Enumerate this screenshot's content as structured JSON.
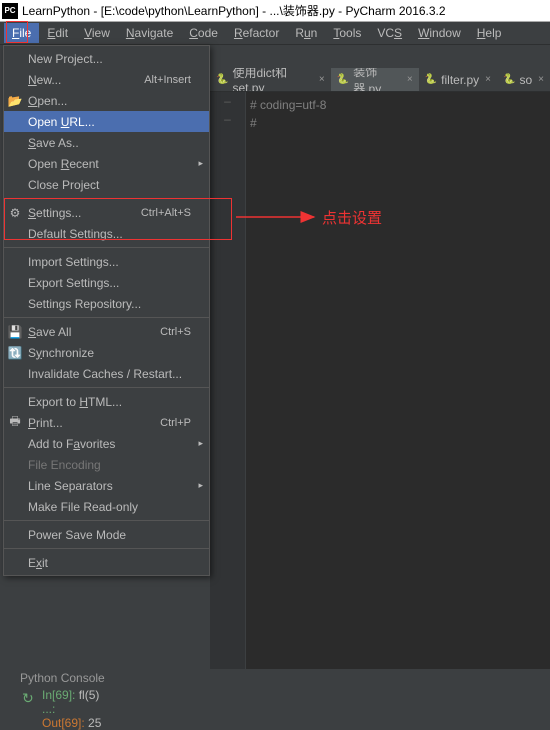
{
  "titlebar": {
    "icon_text": "PC",
    "title": "LearnPython - [E:\\code\\python\\LearnPython] - ...\\装饰器.py - PyCharm 2016.3.2"
  },
  "menubar": {
    "items": [
      {
        "u": "F",
        "rest": "ile",
        "active": true
      },
      {
        "u": "E",
        "rest": "dit"
      },
      {
        "u": "V",
        "rest": "iew"
      },
      {
        "u": "N",
        "rest": "avigate"
      },
      {
        "u": "C",
        "rest": "ode"
      },
      {
        "u": "R",
        "rest": "efactor"
      },
      {
        "u": "",
        "rest": "R",
        "u2": "u",
        "rest2": "n"
      },
      {
        "u": "T",
        "rest": "ools"
      },
      {
        "u": "",
        "rest": "VC",
        "u2": "S",
        "rest2": ""
      },
      {
        "u": "W",
        "rest": "indow"
      },
      {
        "u": "H",
        "rest": "elp"
      }
    ]
  },
  "dropdown": {
    "items": [
      {
        "label": "New Project...",
        "type": "item"
      },
      {
        "label": "New...",
        "shortcut": "Alt+Insert",
        "u": 0,
        "type": "item"
      },
      {
        "label": "Open...",
        "u": 0,
        "icon": "folder",
        "type": "item"
      },
      {
        "label": "Open URL...",
        "u": 5,
        "type": "item",
        "hover": true
      },
      {
        "label": "Save As..",
        "u": 0,
        "type": "item"
      },
      {
        "label": "Open Recent",
        "u": 5,
        "sub": true,
        "type": "item"
      },
      {
        "label": "Close Project",
        "type": "item"
      },
      {
        "type": "sep"
      },
      {
        "label": "Settings...",
        "shortcut": "Ctrl+Alt+S",
        "u": 0,
        "icon": "gear",
        "type": "item"
      },
      {
        "label": "Default Settings...",
        "u": 0,
        "type": "item"
      },
      {
        "type": "sep"
      },
      {
        "label": "Import Settings...",
        "type": "item"
      },
      {
        "label": "Export Settings...",
        "type": "item"
      },
      {
        "label": "Settings Repository...",
        "type": "item"
      },
      {
        "type": "sep"
      },
      {
        "label": "Save All",
        "shortcut": "Ctrl+S",
        "u": 0,
        "icon": "save",
        "type": "item"
      },
      {
        "label": "Synchronize",
        "u": 1,
        "icon": "sync",
        "type": "item"
      },
      {
        "label": "Invalidate Caches / Restart...",
        "type": "item"
      },
      {
        "type": "sep"
      },
      {
        "label": "Export to HTML...",
        "u": 10,
        "type": "item"
      },
      {
        "label": "Print...",
        "shortcut": "Ctrl+P",
        "u": 0,
        "icon": "print",
        "type": "item"
      },
      {
        "label": "Add to Favorites",
        "u": 8,
        "sub": true,
        "type": "item"
      },
      {
        "label": "File Encoding",
        "disabled": true,
        "type": "item"
      },
      {
        "label": "Line Separators",
        "sub": true,
        "type": "item"
      },
      {
        "label": "Make File Read-only",
        "type": "item"
      },
      {
        "type": "sep"
      },
      {
        "label": "Power Save Mode",
        "type": "item"
      },
      {
        "type": "sep"
      },
      {
        "label": "Exit",
        "u": 1,
        "type": "item"
      }
    ]
  },
  "annotation": {
    "text": "点击设置"
  },
  "tabs": {
    "items": [
      {
        "label": "使用dict和set.py",
        "active": false
      },
      {
        "label": "装饰器.py",
        "active": true
      },
      {
        "label": "filter.py",
        "active": false
      },
      {
        "label": "so",
        "active": false
      }
    ]
  },
  "editor": {
    "gutter": [
      "–",
      "–"
    ],
    "lines": [
      "# coding=utf-8",
      "#"
    ]
  },
  "console": {
    "title": "Python Console",
    "in_prompt": "In[69]:",
    "in_code": " fl(5)",
    "cont": "   ...:",
    "out_prompt": "Out[69]:",
    "out_val": " 25"
  }
}
